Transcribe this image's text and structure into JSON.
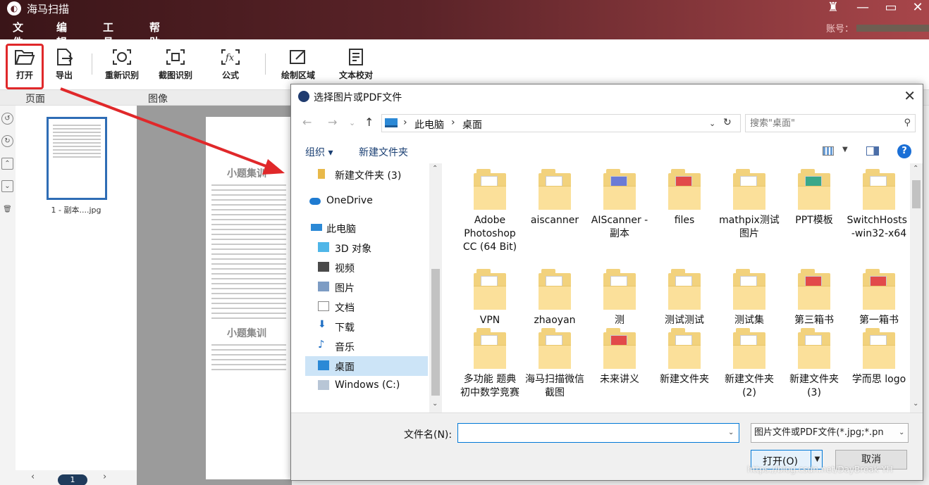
{
  "app": {
    "title": "海马扫描",
    "logo_icon": "app-logo-icon",
    "account_label": "账号："
  },
  "menu": [
    "文件",
    "编辑",
    "工具",
    "帮助"
  ],
  "window_controls": [
    "shirt-icon",
    "minimize-icon",
    "maximize-icon",
    "close-icon"
  ],
  "toolbar": {
    "open": "打开",
    "export": "导出",
    "reocr": "重新识别",
    "screenshot_ocr": "截图识别",
    "formula": "公式",
    "draw_region": "绘制区域",
    "proofread": "文本校对",
    "highlight_color": "#e0282a"
  },
  "panes": {
    "pages_header": "页面",
    "image_header": "图像",
    "thumbnail_caption": "1 - 副本....jpg",
    "page_number": "1",
    "doc_heading_1": "小题集训",
    "doc_heading_2": "小题集训"
  },
  "dialog": {
    "title": "选择图片或PDF文件",
    "address": [
      "此电脑",
      "桌面"
    ],
    "search_placeholder": "搜索\"桌面\"",
    "cmd_organize": "组织 ▾",
    "cmd_new_folder": "新建文件夹",
    "tree": [
      {
        "label": "新建文件夹 (3)",
        "icon": "folder-icon"
      },
      {
        "label": "OneDrive",
        "icon": "cloud-icon"
      },
      {
        "label": "此电脑",
        "icon": "computer-icon"
      },
      {
        "label": "3D 对象",
        "icon": "cube-icon"
      },
      {
        "label": "视频",
        "icon": "video-icon"
      },
      {
        "label": "图片",
        "icon": "pictures-icon"
      },
      {
        "label": "文档",
        "icon": "document-icon"
      },
      {
        "label": "下载",
        "icon": "download-icon"
      },
      {
        "label": "音乐",
        "icon": "music-icon"
      },
      {
        "label": "桌面",
        "icon": "desktop-icon",
        "selected": true
      },
      {
        "label": "Windows (C:)",
        "icon": "drive-icon"
      }
    ],
    "files": [
      "Adobe Photoshop CC (64 Bit)",
      "aiscanner",
      "AIScanner - 副本",
      "files",
      "mathpix测试图片",
      "PPT模板",
      "SwitchHosts!-win32-x64",
      "VPN",
      "zhaoyan",
      "测",
      "测试测试",
      "测试集",
      "第三箱书",
      "第一箱书",
      "多功能 题典 初中数学竞赛",
      "海马扫描微信截图",
      "未来讲义",
      "新建文件夹",
      "新建文件夹 (2)",
      "新建文件夹 (3)",
      "学而思 logo"
    ],
    "filename_label": "文件名(N):",
    "filename_value": "",
    "filter_value": "图片文件或PDF文件(*.jpg;*.pn",
    "open_button": "打开(O)",
    "cancel_button": "取消"
  },
  "watermark": "https://blog.csdn.net/DayBreak YH"
}
